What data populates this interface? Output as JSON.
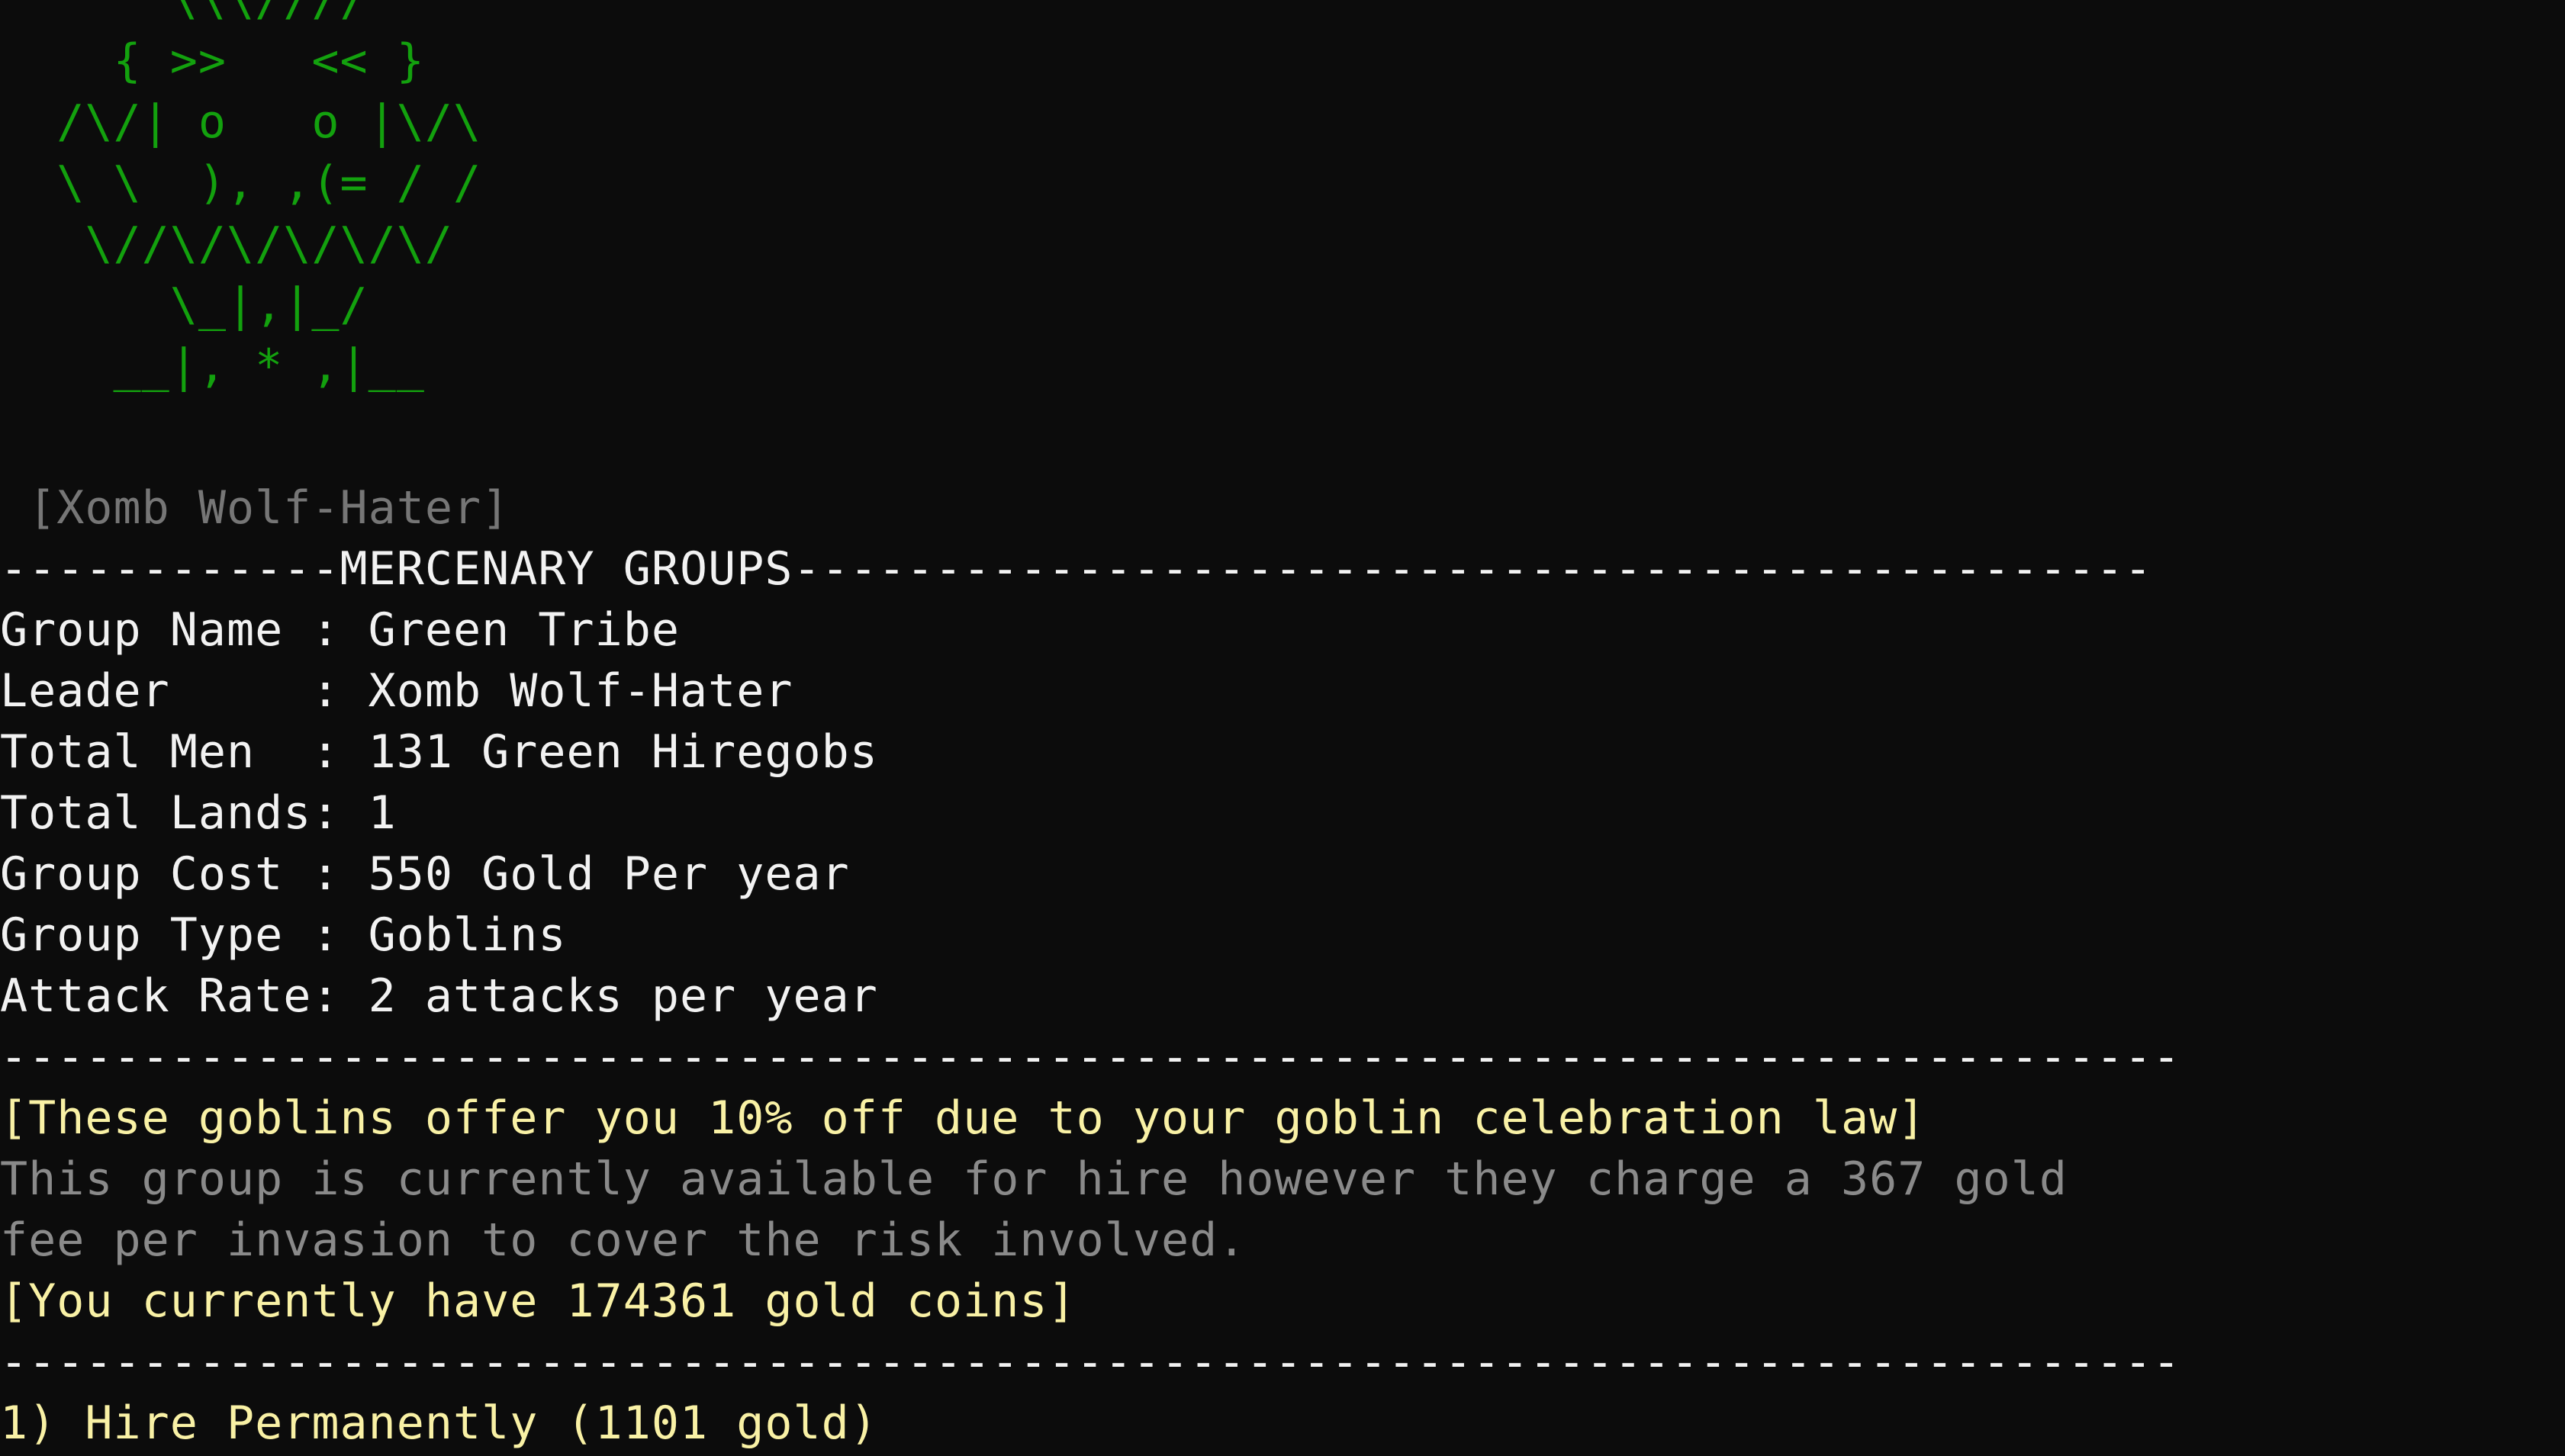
{
  "ascii_art": [
    "      \\\\\\//// ",
    "    { >>   << }",
    "  /\\/| o   o |\\/\\",
    "  \\ \\  ), ,(= / /",
    "   \\//\\/\\/\\/\\/\\/",
    "      \\_|,|_/",
    "    __|, * ,|__"
  ],
  "leader_tag": " [Xomb Wolf-Hater]",
  "section_header": "------------MERCENARY GROUPS------------------------------------------------",
  "details": [
    "Group Name : Green Tribe",
    "Leader     : Xomb Wolf-Hater",
    "Total Men  : 131 Green Hiregobs",
    "Total Lands: 1",
    "Group Cost : 550 Gold Per year",
    "Group Type : Goblins",
    "Attack Rate: 2 attacks per year"
  ],
  "divider": "-----------------------------------------------------------------------------",
  "discount_notice": "[These goblins offer you 10% off due to your goblin celebration law]",
  "availability_line1": "This group is currently available for hire however they charge a 367 gold",
  "availability_line2": "fee per invasion to cover the risk involved.",
  "gold_notice": "[You currently have 174361 gold coins]",
  "menu": [
    "1) Hire Permanently (1101 gold)"
  ],
  "colors": {
    "background": "#0c0c0c",
    "art": "#13a10e",
    "text": "#f2f2f2",
    "highlight": "#f9f1a5",
    "muted": "#767676"
  }
}
